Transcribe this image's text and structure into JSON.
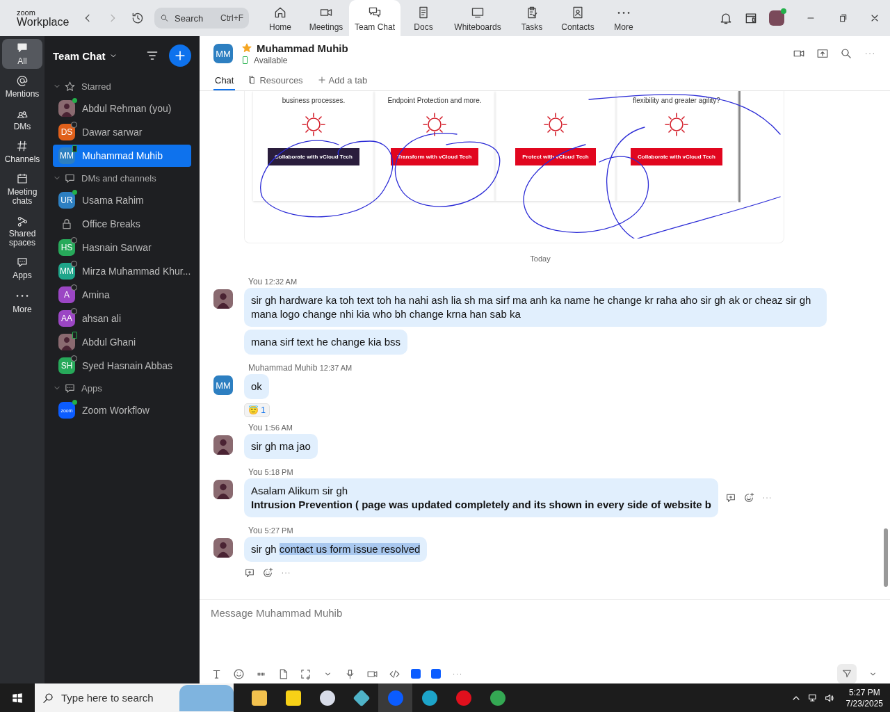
{
  "titlebar": {
    "logo_small": "zoom",
    "logo_big": "Workplace",
    "search": {
      "placeholder": "Search",
      "shortcut": "Ctrl+F"
    },
    "nav_tabs": [
      {
        "label": "Home",
        "selected": false
      },
      {
        "label": "Meetings",
        "selected": false
      },
      {
        "label": "Team Chat",
        "selected": true
      },
      {
        "label": "Docs",
        "selected": false
      },
      {
        "label": "Whiteboards",
        "selected": false
      },
      {
        "label": "Tasks",
        "selected": false
      },
      {
        "label": "Contacts",
        "selected": false
      },
      {
        "label": "More",
        "selected": false
      }
    ]
  },
  "rail": [
    {
      "label": "All",
      "selected": true
    },
    {
      "label": "Mentions",
      "selected": false
    },
    {
      "label": "DMs",
      "selected": false
    },
    {
      "label": "Channels",
      "selected": false
    },
    {
      "label": "Meeting chats",
      "selected": false
    },
    {
      "label": "Shared spaces",
      "selected": false
    },
    {
      "label": "Apps",
      "selected": false
    },
    {
      "label": "More",
      "selected": false
    }
  ],
  "sidebar": {
    "title": "Team Chat",
    "sections": [
      {
        "title": "Starred",
        "expanded": true,
        "items": [
          {
            "name": "Abdul Rehman (you)",
            "kind": "photo",
            "online": true,
            "on_mobile": false,
            "selected": false
          },
          {
            "name": "Dawar sarwar",
            "kind": "initials",
            "initials": "DS",
            "color": "#e0601b",
            "online": false,
            "on_mobile": false,
            "selected": false
          },
          {
            "name": "Muhammad Muhib",
            "kind": "initials",
            "initials": "MM",
            "color": "#2d7fc1",
            "online": true,
            "on_mobile": true,
            "selected": true
          }
        ]
      },
      {
        "title": "DMs and channels",
        "expanded": true,
        "items": [
          {
            "name": "Usama Rahim",
            "kind": "initials",
            "initials": "UR",
            "color": "#2d7fc1",
            "online": true,
            "on_mobile": false,
            "selected": false
          },
          {
            "name": "Office Breaks",
            "kind": "channel",
            "selected": false
          },
          {
            "name": "Hasnain Sarwar",
            "kind": "initials",
            "initials": "HS",
            "color": "#27a95a",
            "online": false,
            "on_mobile": false,
            "selected": false
          },
          {
            "name": "Mirza Muhammad Khur...",
            "kind": "initials",
            "initials": "MM",
            "color": "#1fa58a",
            "online": false,
            "on_mobile": false,
            "selected": false
          },
          {
            "name": "Amina",
            "kind": "initials",
            "initials": "A",
            "color": "#9b46c4",
            "online": false,
            "on_mobile": false,
            "selected": false
          },
          {
            "name": "ahsan ali",
            "kind": "initials",
            "initials": "AA",
            "color": "#9b46c4",
            "online": false,
            "on_mobile": false,
            "selected": false
          },
          {
            "name": "Abdul Ghani",
            "kind": "photo",
            "online": true,
            "on_mobile": true,
            "selected": false
          },
          {
            "name": "Syed Hasnain Abbas",
            "kind": "initials",
            "initials": "SH",
            "color": "#27a95a",
            "online": false,
            "on_mobile": false,
            "selected": false
          }
        ]
      },
      {
        "title": "Apps",
        "expanded": true,
        "items": [
          {
            "name": "Zoom Workflow",
            "kind": "app",
            "app_label": "zoom",
            "online": true,
            "on_mobile": false,
            "selected": false
          }
        ]
      }
    ]
  },
  "header": {
    "initials": "MM",
    "name": "Muhammad Muhib",
    "starred": true,
    "status": "Available",
    "tabs": [
      {
        "label": "Chat",
        "selected": true
      },
      {
        "label": "Resources",
        "selected": false
      },
      {
        "label": "Add a tab",
        "selected": false
      }
    ]
  },
  "preview": {
    "columns": [
      {
        "text": "business processes.",
        "button": "Collaborate with vCloud Tech",
        "kind": "dark"
      },
      {
        "text": "Endpoint Protection and more.",
        "button": "Transform with vCloud Tech",
        "kind": "red"
      },
      {
        "text": "",
        "button": "Protect with vCloud Tech",
        "kind": "red"
      },
      {
        "text": "flexibility and greater agility?",
        "button": "Collaborate with vCloud Tech",
        "kind": "red"
      }
    ]
  },
  "divider": "Today",
  "messages": [
    {
      "sender": "You",
      "time": "12:32 AM",
      "kind": "photo",
      "bubbles": [
        {
          "lines": [
            {
              "segments": [
                {
                  "text": "sir gh hardware ka toh text toh ha nahi ash lia sh ma sirf ma anh ka name he change kr raha aho sir gh ak or cheaz  sir gh mana logo change nhi kia who bh change krna han sab ka",
                  "highlighted": false
                }
              ],
              "bold": false
            }
          ]
        },
        {
          "lines": [
            {
              "segments": [
                {
                  "text": "mana sirf text he change kia bss",
                  "highlighted": false
                }
              ],
              "bold": false
            }
          ]
        }
      ]
    },
    {
      "sender": "Muhammad Muhib",
      "time": "12:37 AM",
      "kind": "initials",
      "initials": "MM",
      "bubbles": [
        {
          "lines": [
            {
              "segments": [
                {
                  "text": "ok",
                  "highlighted": false
                }
              ],
              "bold": false
            }
          ]
        }
      ],
      "reaction": {
        "emoji": "😇",
        "count": "1"
      }
    },
    {
      "sender": "You",
      "time": "1:56 AM",
      "kind": "photo",
      "bubbles": [
        {
          "lines": [
            {
              "segments": [
                {
                  "text": "sir gh ma jao",
                  "highlighted": false
                }
              ],
              "bold": false
            }
          ]
        }
      ]
    },
    {
      "sender": "You",
      "time": "5:18 PM",
      "kind": "photo",
      "hover_actions": true,
      "bubbles": [
        {
          "lines": [
            {
              "segments": [
                {
                  "text": "Asalam Alikum sir gh",
                  "highlighted": false
                }
              ],
              "bold": false
            },
            {
              "segments": [
                {
                  "text": "Intrusion Prevention ( page was  updated completely and its  shown in every side of website b",
                  "highlighted": false
                }
              ],
              "bold": true
            }
          ]
        }
      ]
    },
    {
      "sender": "You",
      "time": "5:27 PM",
      "kind": "photo",
      "actions_below": true,
      "bubbles": [
        {
          "lines": [
            {
              "segments": [
                {
                  "text": "sir gh ",
                  "highlighted": false
                },
                {
                  "text": "contact us form issue resolved",
                  "highlighted": true
                }
              ],
              "bold": false
            }
          ]
        }
      ]
    }
  ],
  "composer": {
    "placeholder": "Message Muhammad Muhib"
  },
  "taskbar": {
    "search_placeholder": "Type here to search",
    "time": "5:27 PM",
    "date": "7/23/2025"
  }
}
